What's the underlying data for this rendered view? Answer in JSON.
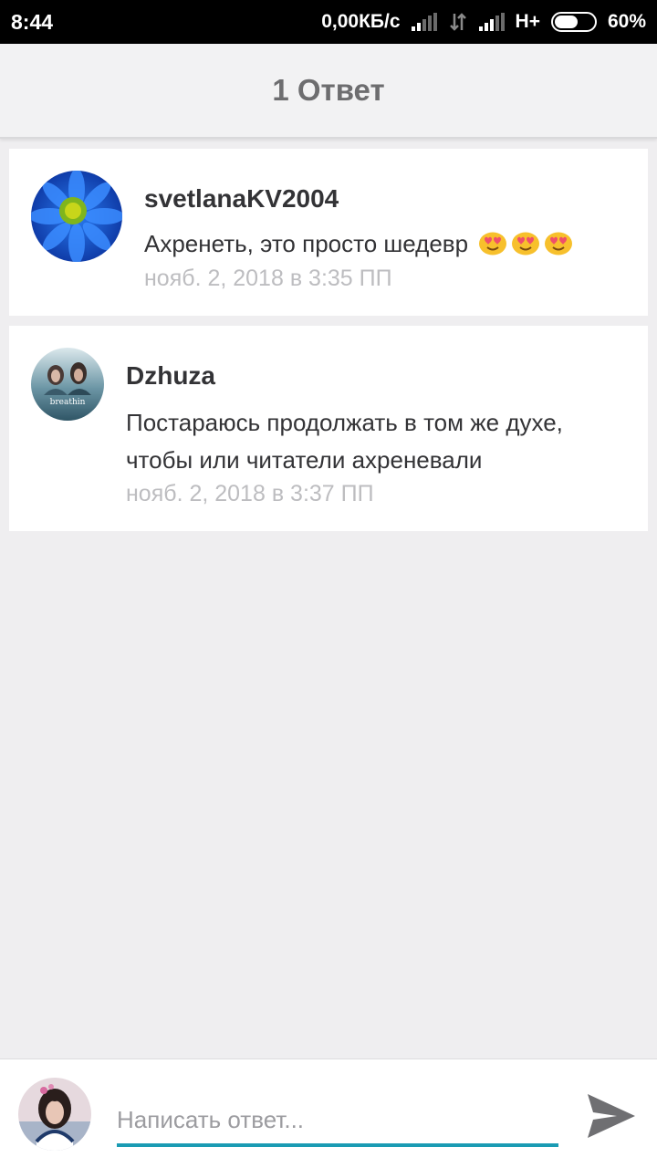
{
  "status_bar": {
    "time": "8:44",
    "network_speed": "0,00КБ/с",
    "network_type": "H+",
    "battery": "60%",
    "battery_level": 0.6
  },
  "header": {
    "title": "1 Ответ"
  },
  "comments": [
    {
      "author": "svetlanaKV2004",
      "text": "Ахренеть, это просто шедевр",
      "emoji": [
        "heart-eyes-emoji",
        "heart-eyes-emoji",
        "heart-eyes-emoji"
      ],
      "timestamp": "нояб. 2, 2018 в 3:35 ПП"
    },
    {
      "author": "Dzhuza",
      "text_line1": "Постараюсь продолжать в том же духе,",
      "text_line2": "чтобы или читатели ахреневали",
      "timestamp": "нояб. 2, 2018 в 3:37 ПП",
      "avatar_text": "breathin"
    }
  ],
  "reply": {
    "placeholder": "Написать ответ...",
    "send_icon": "send-icon"
  },
  "colors": {
    "accent": "#1a9bb3",
    "background": "#efeef0"
  }
}
